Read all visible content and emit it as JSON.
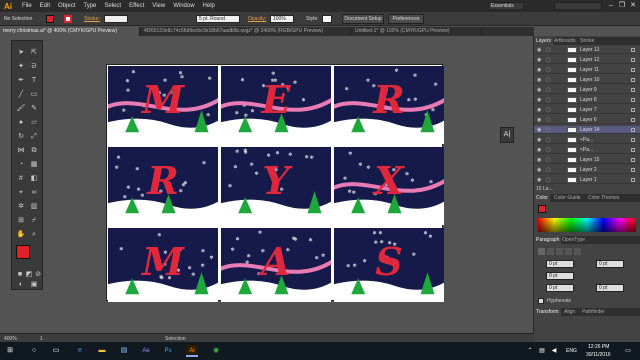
{
  "menubar": {
    "app_logo": "Ai",
    "items": [
      "File",
      "Edit",
      "Object",
      "Type",
      "Select",
      "Effect",
      "View",
      "Window",
      "Help"
    ],
    "workspace": "Essentials",
    "window_controls": [
      "–",
      "❐",
      "✕"
    ]
  },
  "controlbar": {
    "selection": "No Selection",
    "stroke_label": "Stroke:",
    "brush_value": "5 pt. Round",
    "opacity_label": "Opacity:",
    "opacity_value": "100%",
    "style_label": "Style:",
    "document_setup": "Document Setup",
    "preferences": "Preferences"
  },
  "tabs": [
    {
      "label": "merry christmas.ai* @ 400% (CMYK/GPU Preview)",
      "active": true
    },
    {
      "label": "4f265133e8c74c56d9ecbe3e18b67aadb5b.svgz* @ 2400% (RGB/GPU Preview)",
      "active": false
    },
    {
      "label": "Untitled-1* @ 100% (CMYK/GPU Preview)",
      "active": false
    }
  ],
  "artboard": {
    "letters": [
      "M",
      "E",
      "R",
      "R",
      "Y",
      "X",
      "M",
      "A",
      "S"
    ],
    "background_color": "#151a4a",
    "ribbon_color": "#e0283c",
    "ribbon_light_color": "#e87ab4",
    "tree_color": "#1ea83c",
    "snow_color": "#ffffff"
  },
  "layers_panel": {
    "tabs": [
      "Layers",
      "Artboards",
      "Stroke"
    ],
    "layers": [
      {
        "name": "Layer 13",
        "selected": false
      },
      {
        "name": "Layer 12",
        "selected": false
      },
      {
        "name": "Layer 11",
        "selected": false
      },
      {
        "name": "Layer 10",
        "selected": false
      },
      {
        "name": "Layer 9",
        "selected": false
      },
      {
        "name": "Layer 8",
        "selected": false
      },
      {
        "name": "Layer 7",
        "selected": false
      },
      {
        "name": "Layer 6",
        "selected": false
      },
      {
        "name": "Layer 14",
        "selected": true
      },
      {
        "name": "<Pa...",
        "selected": false
      },
      {
        "name": "<Pa...",
        "selected": false
      },
      {
        "name": "Layer 15",
        "selected": false
      },
      {
        "name": "Layer 2",
        "selected": false
      },
      {
        "name": "Layer 1",
        "selected": false
      }
    ],
    "footer": "15 La..."
  },
  "color_panel": {
    "tabs": [
      "Color",
      "Color Guide",
      "Color Themes"
    ]
  },
  "paragraph_panel": {
    "tabs": [
      "Paragraph",
      "OpenType"
    ],
    "values": [
      "0 pt",
      "0 pt",
      "0 pt",
      "0 pt",
      "0 pt"
    ],
    "hyphenate_label": "Hyphenate"
  },
  "transform_panel": {
    "tabs": [
      "Transform",
      "Align",
      "Pathfinder"
    ]
  },
  "statusbar": {
    "zoom": "400%",
    "page": "1",
    "tool": "Selection"
  },
  "taskbar": {
    "time": "12:26 PM",
    "date": "30/11/2016",
    "language": "ENG"
  }
}
